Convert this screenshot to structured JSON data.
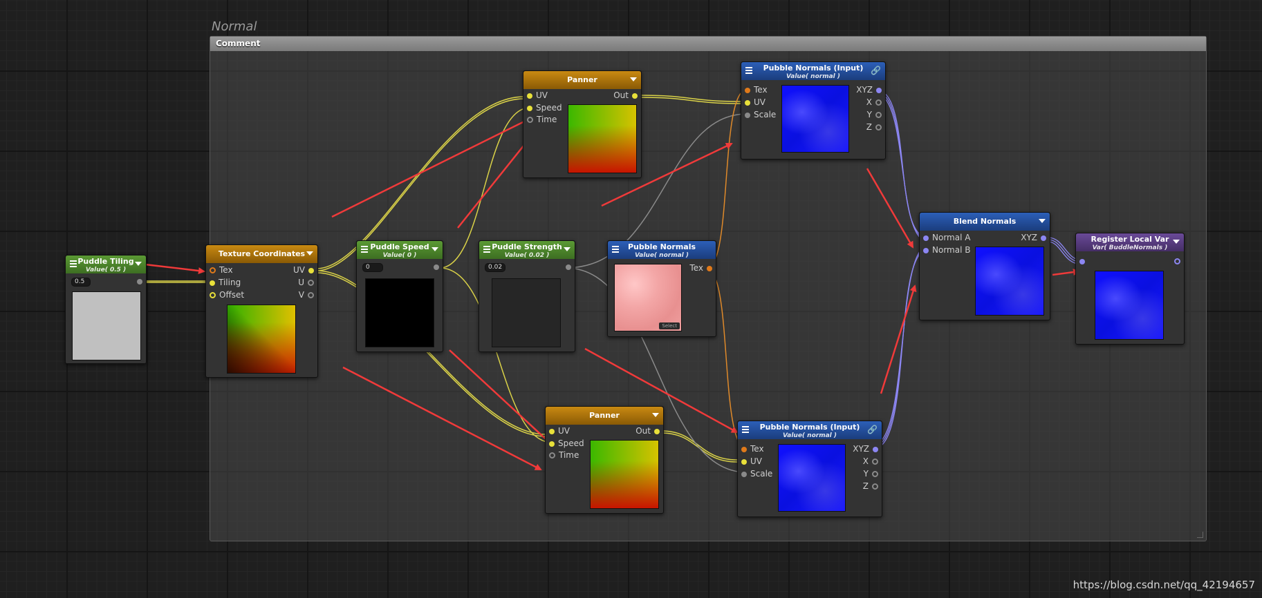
{
  "group": {
    "title": "Normal"
  },
  "comment": {
    "label": "Comment"
  },
  "nodes": {
    "puddle_tiling": {
      "title": "Puddle Tiling",
      "subtitle": "Value( 0.5 )",
      "value": "0.5"
    },
    "texture_coordinates": {
      "title": "Texture Coordinates",
      "inputs": [
        "Tex",
        "Tiling",
        "Offset"
      ],
      "outputs": [
        "UV",
        "U",
        "V"
      ]
    },
    "puddle_speed": {
      "title": "Puddle Speed",
      "subtitle": "Value( 0 )",
      "value": "0"
    },
    "puddle_strength": {
      "title": "Puddle Strength",
      "subtitle": "Value( 0.02 )",
      "value": "0.02"
    },
    "panner_top": {
      "title": "Panner",
      "inputs": [
        "UV",
        "Speed",
        "Time"
      ],
      "output": "Out"
    },
    "panner_bottom": {
      "title": "Panner",
      "inputs": [
        "UV",
        "Speed",
        "Time"
      ],
      "output": "Out"
    },
    "pubble_normals": {
      "title": "Pubble Normals",
      "subtitle": "Value( normal )",
      "output": "Tex",
      "select_label": "Select"
    },
    "pubble_normals_input_top": {
      "title": "Pubble Normals (Input)",
      "subtitle": "Value( normal )",
      "inputs": [
        "Tex",
        "UV",
        "Scale"
      ],
      "outputs": [
        "XYZ",
        "X",
        "Y",
        "Z"
      ]
    },
    "pubble_normals_input_bottom": {
      "title": "Pubble Normals (Input)",
      "subtitle": "Value( normal )",
      "inputs": [
        "Tex",
        "UV",
        "Scale"
      ],
      "outputs": [
        "XYZ",
        "X",
        "Y",
        "Z"
      ]
    },
    "blend_normals": {
      "title": "Blend Normals",
      "inputs": [
        "Normal A",
        "Normal B"
      ],
      "output": "XYZ"
    },
    "register_local_var": {
      "title": "Register Local Var",
      "subtitle": "Var( BuddleNormals )"
    }
  },
  "watermark": "https://blog.csdn.net/qq_42194657",
  "colors": {
    "uv_wire": "#e0d84a",
    "float_wire": "#8a8a8a",
    "tex_wire": "#e08a2a",
    "normal_wire": "#8c86f2",
    "annotation_arrow": "#f03a3a"
  }
}
